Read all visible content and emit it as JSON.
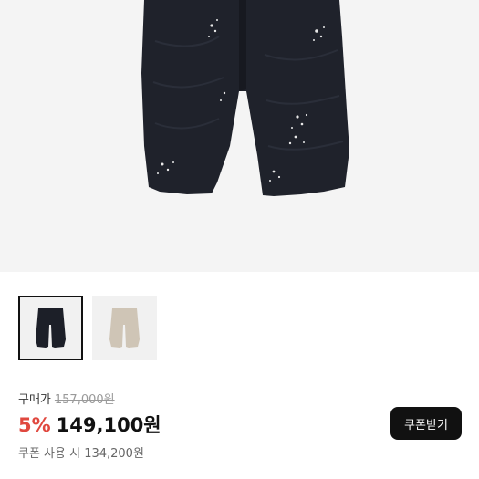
{
  "product": {
    "images": [
      {
        "icon": "black-pants-image",
        "color": "#1c1f28",
        "selected": true
      },
      {
        "icon": "beige-pants-image",
        "color": "#cfc5b6",
        "selected": false
      }
    ]
  },
  "price": {
    "label": "구매가",
    "original": "157,000원",
    "discount": "5%",
    "sale": "149,100원",
    "coupon_text": "쿠폰 사용 시 134,200원"
  },
  "coupon_button": {
    "label": "쿠폰받기"
  },
  "colors": {
    "discount": "#e0483f",
    "background": "#f4f4f4",
    "button": "#111111"
  }
}
